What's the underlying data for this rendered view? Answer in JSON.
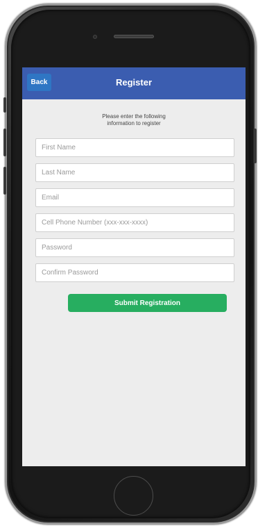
{
  "header": {
    "back_label": "Back",
    "title": "Register"
  },
  "instructions": "Please enter the following information to register",
  "form": {
    "first_name_placeholder": "First Name",
    "last_name_placeholder": "Last Name",
    "email_placeholder": "Email",
    "phone_placeholder": "Cell Phone Number (xxx-xxx-xxxx)",
    "password_placeholder": "Password",
    "confirm_password_placeholder": "Confirm Password",
    "submit_label": "Submit Registration"
  },
  "colors": {
    "navbar": "#3b5db0",
    "back_button": "#2f76c4",
    "submit_button": "#27ae60",
    "screen_background": "#ededed",
    "device_body": "#1b1b1b"
  }
}
